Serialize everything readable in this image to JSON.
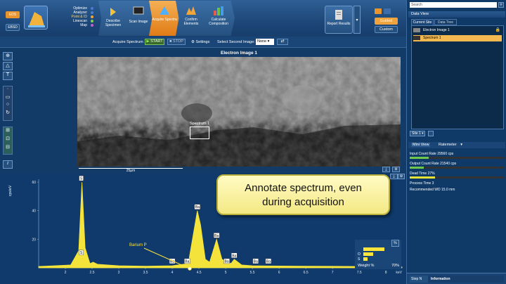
{
  "toolbar": {
    "eds": "EDS",
    "ebsd": "EBSD",
    "nav_items": [
      "Optimize",
      "Analyzer",
      "Point & ID",
      "Linescan",
      "Map"
    ],
    "steps": [
      "Describe Specimen",
      "Scan Image",
      "Acquire Spectra",
      "Confirm Elements",
      "Calculate Composition"
    ],
    "report": "Report Results",
    "guided": "Guided",
    "custom": "Custom"
  },
  "acq": {
    "label": "Acquire Spectrum",
    "start": "START",
    "stop": "STOP",
    "settings": "Settings",
    "second": "Select Second Image:",
    "none": "None"
  },
  "image": {
    "title": "Electron Image 1",
    "spectrum_label": "Spectrum 1",
    "scale": "25µm"
  },
  "spectrum": {
    "ylabel": "cps/eV",
    "xunit": "keV",
    "annotation": "Barium P",
    "peaks": [
      "S",
      "S",
      "Ba",
      "Ba",
      "Ba",
      "Ba",
      "Ba",
      "Ba",
      "Ba",
      "Ba"
    ],
    "ticks_y": [
      "60",
      "40",
      "20"
    ],
    "ticks_x": [
      "2",
      "2.5",
      "3",
      "3.5",
      "4",
      "4.5",
      "5",
      "5.5",
      "6",
      "6.5",
      "7",
      "7.5",
      "8"
    ],
    "weight_label": "Weight %",
    "weight_value": "70%",
    "el_o": "O",
    "el_s": "S",
    "pct": "%"
  },
  "callout": {
    "line1": "Annotate spectrum, even",
    "line2": "during acquisition"
  },
  "sidebar": {
    "search": "Search",
    "data_view": "Data View",
    "tabs": [
      "Current Site",
      "Data Tree"
    ],
    "items": [
      "Electron Image 1",
      "Spectrum 1"
    ],
    "site": "Site 1",
    "mini_tabs": [
      "Mini View",
      "Ratemeter"
    ],
    "stats": [
      "Input Count Rate 29560 cps",
      "Output Count Rate 21540 cps",
      "Dead Time 27%",
      "Process Time 3",
      "Recommended WD 15.0 mm"
    ],
    "step_tab": "Step N",
    "info_tab": "Information"
  },
  "chart_data": {
    "type": "line",
    "xlabel": "keV",
    "ylabel": "cps/eV",
    "xlim": [
      1.5,
      8.3
    ],
    "ylim": [
      0,
      62
    ],
    "x": [
      1.5,
      1.8,
      2.1,
      2.25,
      2.31,
      2.37,
      2.46,
      2.52,
      2.6,
      3.0,
      3.5,
      4.0,
      4.3,
      4.47,
      4.53,
      4.62,
      4.7,
      4.83,
      4.93,
      5.1,
      5.16,
      5.3,
      5.5,
      6.0,
      6.5,
      7.0,
      7.5,
      8.0,
      8.3
    ],
    "y": [
      1,
      1.5,
      2,
      12,
      60,
      14,
      3,
      4,
      2.5,
      1.5,
      1.2,
      1.5,
      3,
      40,
      30,
      6,
      4,
      20,
      6,
      3,
      6,
      2,
      1.5,
      1.3,
      1.2,
      1.1,
      1,
      0.8,
      0.6
    ]
  }
}
